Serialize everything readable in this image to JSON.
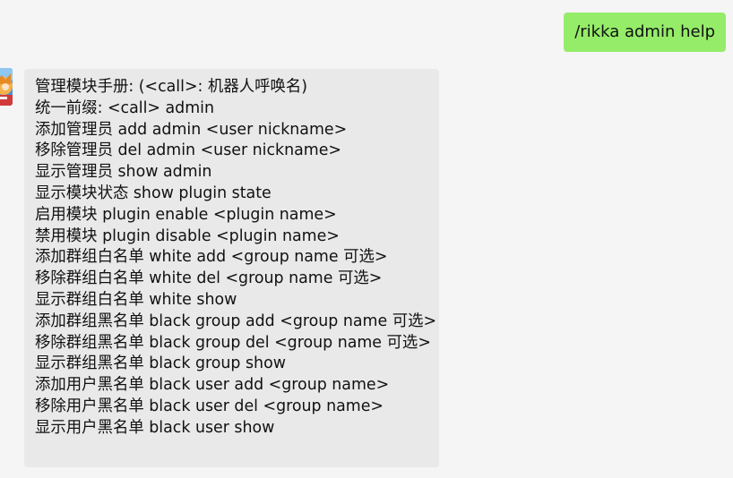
{
  "chat": {
    "sent_message": {
      "text": "/rikka admin help",
      "bubble_color": "#95ec69"
    },
    "received_message": {
      "bubble_color": "#e9e9e9",
      "lines": [
        "管理模块手册: (<call>: 机器人呼唤名)",
        "统一前缀: <call> admin",
        "添加管理员 add admin <user nickname>",
        "移除管理员 del admin <user nickname>",
        "显示管理员 show admin",
        "显示模块状态 show plugin state",
        "启用模块 plugin enable <plugin name>",
        "禁用模块 plugin disable <plugin name>",
        "添加群组白名单 white add <group name 可选>",
        "移除群组白名单 white del <group name 可选>",
        "显示群组白名单 white show",
        "添加群组黑名单 black group add <group name 可选>",
        "移除群组黑名单 black group del <group name 可选>",
        "显示群组黑名单 black group show",
        "添加用户黑名单 black user add <group name>",
        "移除用户黑名单 black user del <group name>",
        "显示用户黑名单 black user show"
      ]
    },
    "background_color": "#f5f5f5",
    "avatar_icon": "bot-avatar-icon"
  }
}
